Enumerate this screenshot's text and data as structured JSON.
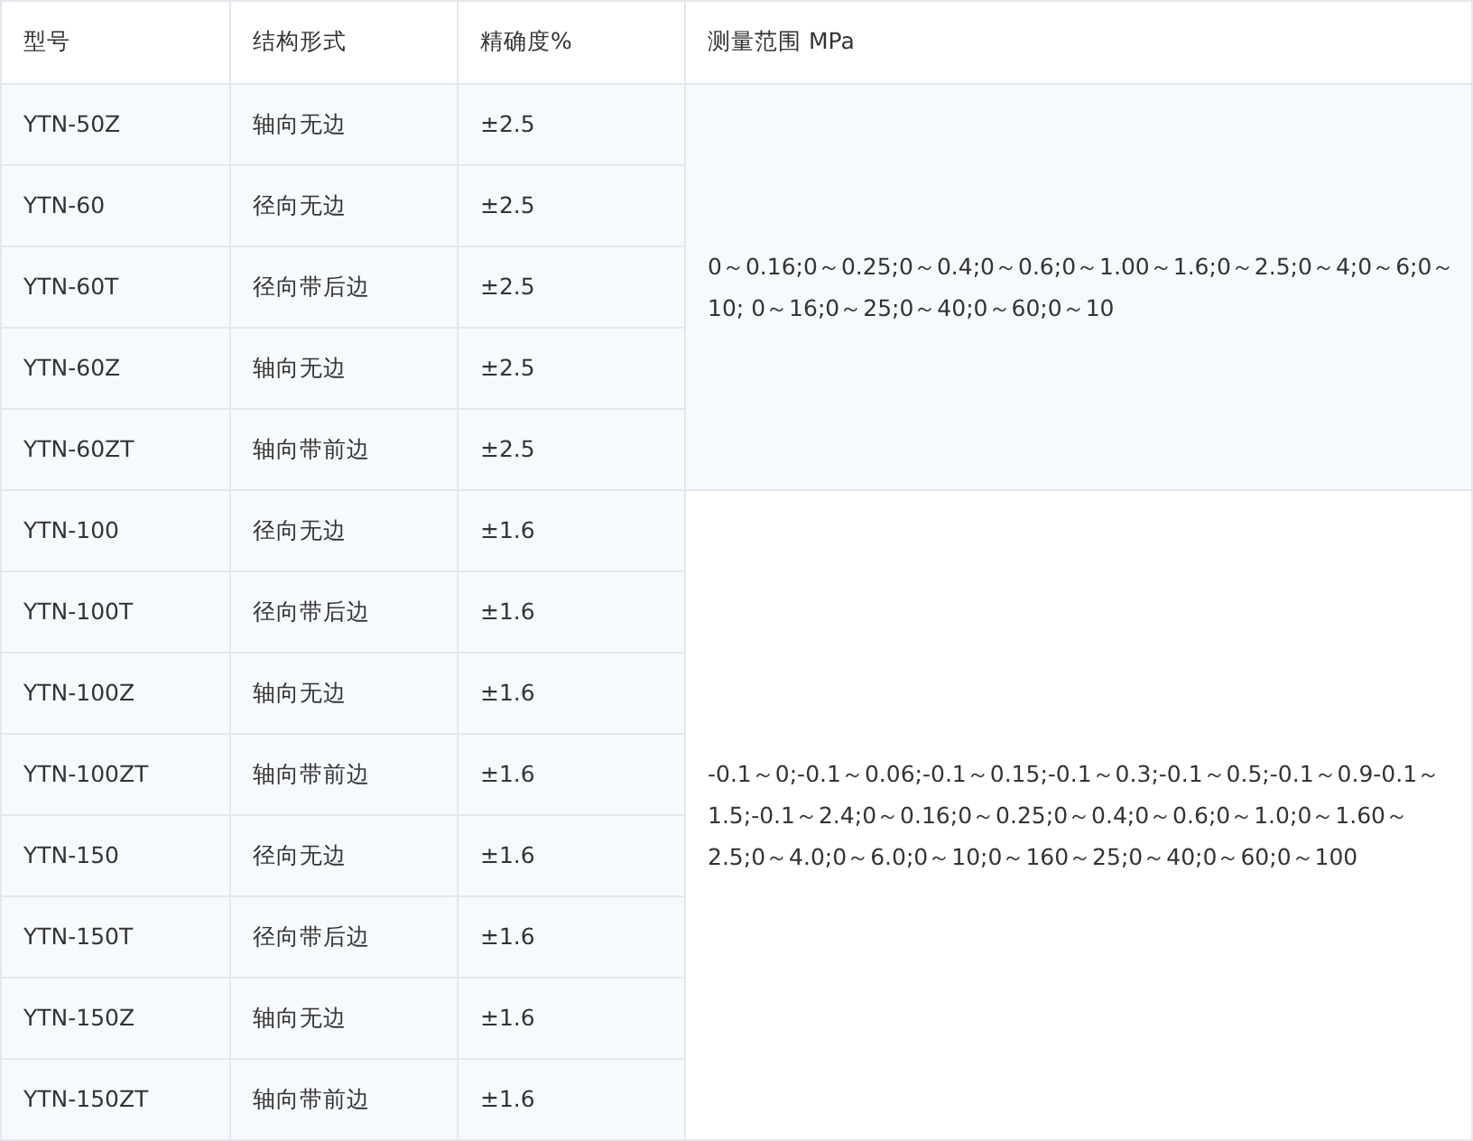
{
  "table": {
    "columns": [
      "型号",
      "结构形式",
      "精确度%",
      "测量范围 MPa"
    ],
    "groups": [
      {
        "range": "0～0.16;0～0.25;0～0.4;0～0.6;0～1.00～1.6;0～2.5;0～4;0～6;0～10; 0～16;0～25;0～40;0～60;0～10",
        "rows": [
          [
            "YTN-50Z",
            "轴向无边",
            "±2.5"
          ],
          [
            "YTN-60",
            "径向无边",
            "±2.5"
          ],
          [
            "YTN-60T",
            "径向带后边",
            "±2.5"
          ],
          [
            "YTN-60Z",
            "轴向无边",
            "±2.5"
          ],
          [
            "YTN-60ZT",
            "轴向带前边",
            "±2.5"
          ]
        ]
      },
      {
        "range": "-0.1～0;-0.1～0.06;-0.1～0.15;-0.1～0.3;-0.1～0.5;-0.1～0.9-0.1～1.5;-0.1～2.4;0～0.16;0～0.25;0～0.4;0～0.6;0～1.0;0～1.60～2.5;0～4.0;0～6.0;0～10;0～160～25;0～40;0～60;0～100",
        "rows": [
          [
            "YTN-100",
            "径向无边",
            "±1.6"
          ],
          [
            "YTN-100T",
            "径向带后边",
            "±1.6"
          ],
          [
            "YTN-100Z",
            "轴向无边",
            "±1.6"
          ],
          [
            "YTN-100ZT",
            "轴向带前边",
            "±1.6"
          ],
          [
            "YTN-150",
            "径向无边",
            "±1.6"
          ],
          [
            "YTN-150T",
            "径向带后边",
            "±1.6"
          ],
          [
            "YTN-150Z",
            "轴向无边",
            "±1.6"
          ],
          [
            "YTN-150ZT",
            "轴向带前边",
            "±1.6"
          ]
        ]
      }
    ]
  }
}
